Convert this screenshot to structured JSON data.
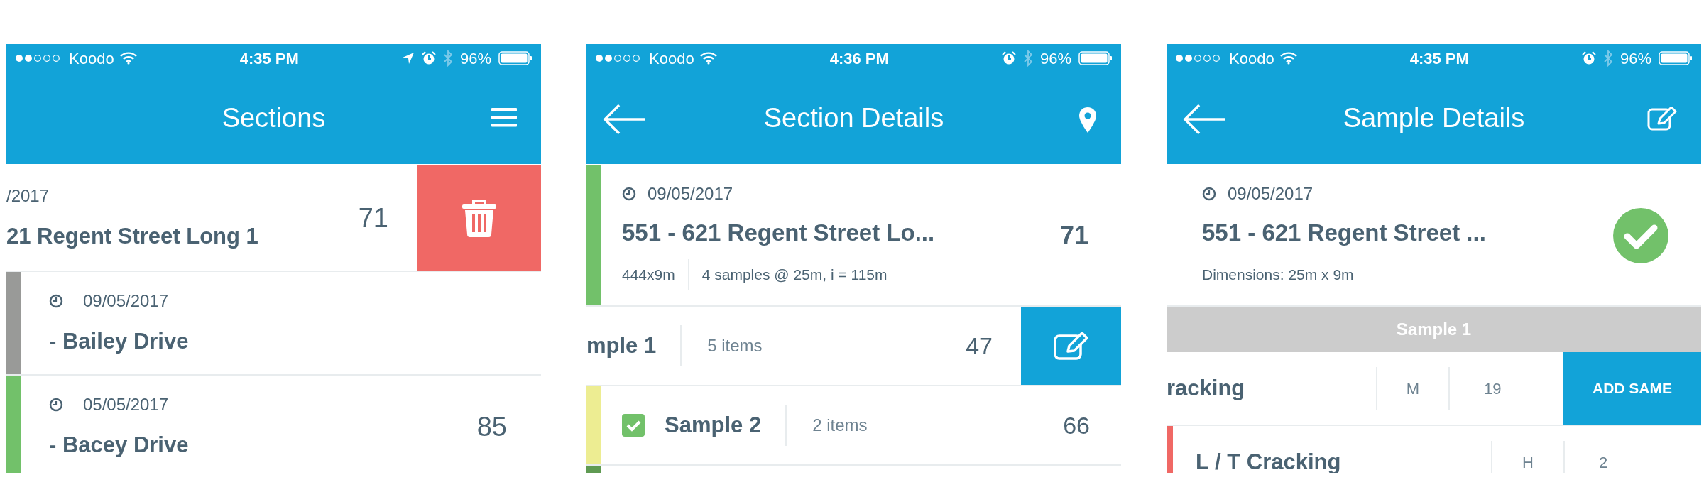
{
  "phones": [
    {
      "status": {
        "carrier": "Koodo",
        "time": "4:35 PM",
        "battery": "96%",
        "location": true
      },
      "nav": {
        "title": "Sections",
        "right": {
          "kind": "menu"
        }
      },
      "rows": [
        {
          "kind": "section",
          "date": "/2017",
          "title": "21 Regent Street Long 1",
          "score": "71",
          "action": {
            "kind": "delete"
          }
        },
        {
          "kind": "section",
          "color": "#999a98",
          "date": "09/05/2017",
          "title": "- Bailey Drive"
        },
        {
          "kind": "section",
          "color": "#72c16a",
          "date": "05/05/2017",
          "title": "- Bacey Drive",
          "score": "85"
        }
      ]
    },
    {
      "status": {
        "carrier": "Koodo",
        "time": "4:36 PM",
        "battery": "96%"
      },
      "nav": {
        "title": "Section Details",
        "left": {
          "kind": "back"
        },
        "right": {
          "kind": "pin"
        }
      },
      "rows": [
        {
          "kind": "card",
          "color": "#72c16a",
          "date": "09/05/2017",
          "title": "551 - 621 Regent Street Lo...",
          "meta": [
            "444x9m",
            "4 samples @ 25m, i = 115m"
          ],
          "score": "71"
        },
        {
          "kind": "sample",
          "label": "mple 1",
          "items": "5 items",
          "score": "47",
          "action": {
            "kind": "edit"
          }
        },
        {
          "kind": "sample",
          "color": "#eded92",
          "label": "Sample 2",
          "items": "2 items",
          "score": "66",
          "checked": true
        },
        {
          "kind": "stub",
          "color": "#5f9a52"
        }
      ]
    },
    {
      "status": {
        "carrier": "Koodo",
        "time": "4:35 PM",
        "battery": "96%"
      },
      "nav": {
        "title": "Sample Details",
        "left": {
          "kind": "back"
        },
        "right": {
          "kind": "edit"
        }
      },
      "rows": [
        {
          "kind": "card",
          "date": "09/05/2017",
          "title": "551 - 621 Regent Street ...",
          "meta": [
            "Dimensions: 25m x 9m"
          ],
          "done": true
        },
        {
          "kind": "band",
          "label": "Sample 1"
        },
        {
          "kind": "distress",
          "label": "racking",
          "severity": "M",
          "count": "19",
          "action": {
            "kind": "add_same",
            "label": "ADD SAME"
          }
        },
        {
          "kind": "distress",
          "color": "#f06865",
          "label": "L / T Cracking",
          "severity": "H",
          "count": "2"
        }
      ]
    }
  ]
}
